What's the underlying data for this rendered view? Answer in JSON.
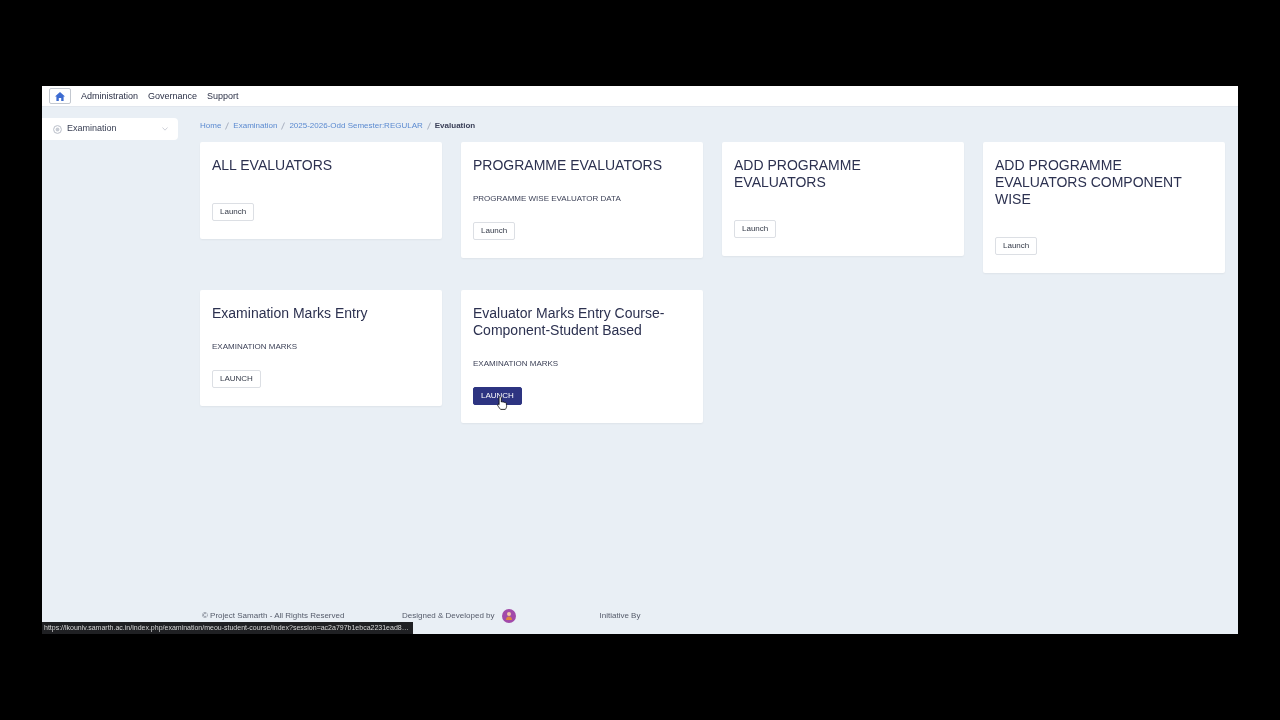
{
  "nav": {
    "links": [
      "Administration",
      "Governance",
      "Support"
    ]
  },
  "sidebar": {
    "items": [
      {
        "label": "Examination"
      }
    ]
  },
  "breadcrumb": [
    {
      "label": "Home",
      "active": false
    },
    {
      "label": "Examination",
      "active": false
    },
    {
      "label": "2025-2026-Odd Semester:REGULAR",
      "active": false
    },
    {
      "label": "Evaluation",
      "active": true
    }
  ],
  "cards": [
    {
      "title": "ALL EVALUATORS",
      "button": {
        "label": "Launch",
        "hovered": false
      }
    },
    {
      "title": "PROGRAMME EVALUATORS",
      "subtitle": "PROGRAMME WISE EVALUATOR DATA",
      "button": {
        "label": "Launch",
        "hovered": false
      }
    },
    {
      "title": "ADD PROGRAMME EVALUATORS",
      "button": {
        "label": "Launch",
        "hovered": false
      }
    },
    {
      "title": "ADD PROGRAMME EVALUATORS COMPONENT WISE",
      "button": {
        "label": "Launch",
        "hovered": false
      }
    },
    {
      "title": "Examination Marks Entry",
      "subtitle": "EXAMINATION MARKS",
      "button": {
        "label": "LAUNCH",
        "hovered": false
      }
    },
    {
      "title": "Evaluator Marks Entry Course-Component-Student Based",
      "subtitle": "EXAMINATION MARKS",
      "button": {
        "label": "LAUNCH",
        "hovered": true
      }
    }
  ],
  "footer": {
    "copyright": "© Project Samarth - All Rights Reserved",
    "credit": "Designed & Developed by",
    "initiative": "Initiative By"
  },
  "status_bar": {
    "url": "https://lkouniv.samarth.ac.in/index.php/examination/meou-student-course/index?session=ac2a797b1ebca2231ead8…"
  }
}
